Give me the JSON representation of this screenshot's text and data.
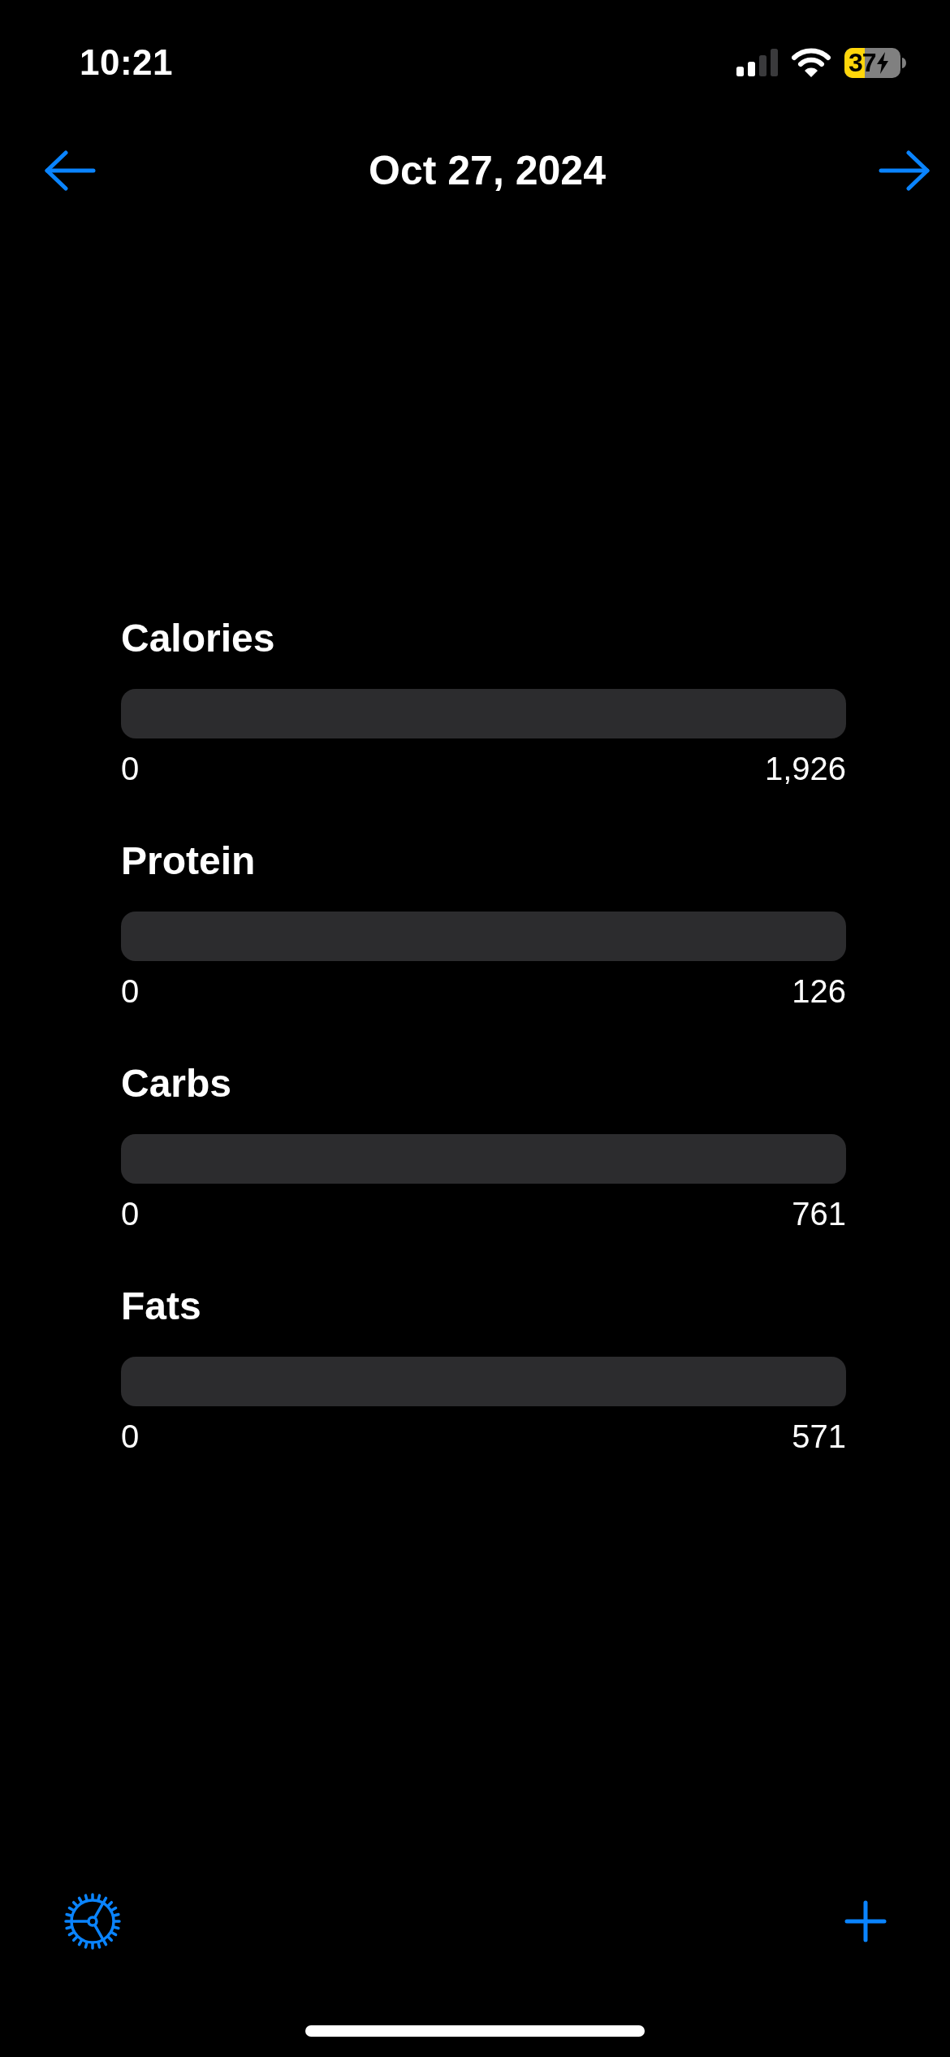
{
  "status_bar": {
    "time": "10:21",
    "battery": "37",
    "charging": true
  },
  "header": {
    "title": "Oct 27, 2024"
  },
  "nutrients": [
    {
      "label": "Calories",
      "level": 0,
      "min": "0",
      "max": "1,926"
    },
    {
      "label": "Protein",
      "level": 0,
      "min": "0",
      "max": "126"
    },
    {
      "label": "Carbs",
      "level": 0,
      "min": "0",
      "max": "761"
    },
    {
      "label": "Fats",
      "level": 0,
      "min": "0",
      "max": "571"
    }
  ]
}
